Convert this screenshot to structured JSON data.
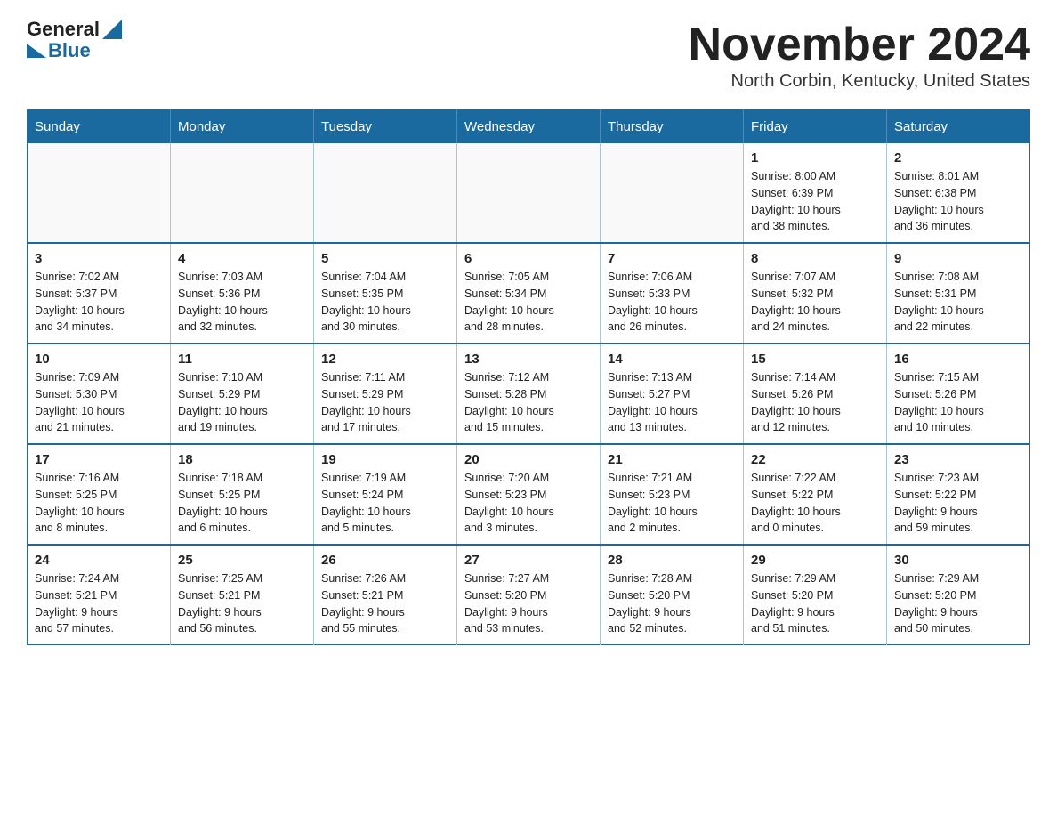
{
  "logo": {
    "general": "General",
    "blue": "Blue"
  },
  "title": "November 2024",
  "subtitle": "North Corbin, Kentucky, United States",
  "days_of_week": [
    "Sunday",
    "Monday",
    "Tuesday",
    "Wednesday",
    "Thursday",
    "Friday",
    "Saturday"
  ],
  "weeks": [
    [
      {
        "day": "",
        "info": ""
      },
      {
        "day": "",
        "info": ""
      },
      {
        "day": "",
        "info": ""
      },
      {
        "day": "",
        "info": ""
      },
      {
        "day": "",
        "info": ""
      },
      {
        "day": "1",
        "info": "Sunrise: 8:00 AM\nSunset: 6:39 PM\nDaylight: 10 hours\nand 38 minutes."
      },
      {
        "day": "2",
        "info": "Sunrise: 8:01 AM\nSunset: 6:38 PM\nDaylight: 10 hours\nand 36 minutes."
      }
    ],
    [
      {
        "day": "3",
        "info": "Sunrise: 7:02 AM\nSunset: 5:37 PM\nDaylight: 10 hours\nand 34 minutes."
      },
      {
        "day": "4",
        "info": "Sunrise: 7:03 AM\nSunset: 5:36 PM\nDaylight: 10 hours\nand 32 minutes."
      },
      {
        "day": "5",
        "info": "Sunrise: 7:04 AM\nSunset: 5:35 PM\nDaylight: 10 hours\nand 30 minutes."
      },
      {
        "day": "6",
        "info": "Sunrise: 7:05 AM\nSunset: 5:34 PM\nDaylight: 10 hours\nand 28 minutes."
      },
      {
        "day": "7",
        "info": "Sunrise: 7:06 AM\nSunset: 5:33 PM\nDaylight: 10 hours\nand 26 minutes."
      },
      {
        "day": "8",
        "info": "Sunrise: 7:07 AM\nSunset: 5:32 PM\nDaylight: 10 hours\nand 24 minutes."
      },
      {
        "day": "9",
        "info": "Sunrise: 7:08 AM\nSunset: 5:31 PM\nDaylight: 10 hours\nand 22 minutes."
      }
    ],
    [
      {
        "day": "10",
        "info": "Sunrise: 7:09 AM\nSunset: 5:30 PM\nDaylight: 10 hours\nand 21 minutes."
      },
      {
        "day": "11",
        "info": "Sunrise: 7:10 AM\nSunset: 5:29 PM\nDaylight: 10 hours\nand 19 minutes."
      },
      {
        "day": "12",
        "info": "Sunrise: 7:11 AM\nSunset: 5:29 PM\nDaylight: 10 hours\nand 17 minutes."
      },
      {
        "day": "13",
        "info": "Sunrise: 7:12 AM\nSunset: 5:28 PM\nDaylight: 10 hours\nand 15 minutes."
      },
      {
        "day": "14",
        "info": "Sunrise: 7:13 AM\nSunset: 5:27 PM\nDaylight: 10 hours\nand 13 minutes."
      },
      {
        "day": "15",
        "info": "Sunrise: 7:14 AM\nSunset: 5:26 PM\nDaylight: 10 hours\nand 12 minutes."
      },
      {
        "day": "16",
        "info": "Sunrise: 7:15 AM\nSunset: 5:26 PM\nDaylight: 10 hours\nand 10 minutes."
      }
    ],
    [
      {
        "day": "17",
        "info": "Sunrise: 7:16 AM\nSunset: 5:25 PM\nDaylight: 10 hours\nand 8 minutes."
      },
      {
        "day": "18",
        "info": "Sunrise: 7:18 AM\nSunset: 5:25 PM\nDaylight: 10 hours\nand 6 minutes."
      },
      {
        "day": "19",
        "info": "Sunrise: 7:19 AM\nSunset: 5:24 PM\nDaylight: 10 hours\nand 5 minutes."
      },
      {
        "day": "20",
        "info": "Sunrise: 7:20 AM\nSunset: 5:23 PM\nDaylight: 10 hours\nand 3 minutes."
      },
      {
        "day": "21",
        "info": "Sunrise: 7:21 AM\nSunset: 5:23 PM\nDaylight: 10 hours\nand 2 minutes."
      },
      {
        "day": "22",
        "info": "Sunrise: 7:22 AM\nSunset: 5:22 PM\nDaylight: 10 hours\nand 0 minutes."
      },
      {
        "day": "23",
        "info": "Sunrise: 7:23 AM\nSunset: 5:22 PM\nDaylight: 9 hours\nand 59 minutes."
      }
    ],
    [
      {
        "day": "24",
        "info": "Sunrise: 7:24 AM\nSunset: 5:21 PM\nDaylight: 9 hours\nand 57 minutes."
      },
      {
        "day": "25",
        "info": "Sunrise: 7:25 AM\nSunset: 5:21 PM\nDaylight: 9 hours\nand 56 minutes."
      },
      {
        "day": "26",
        "info": "Sunrise: 7:26 AM\nSunset: 5:21 PM\nDaylight: 9 hours\nand 55 minutes."
      },
      {
        "day": "27",
        "info": "Sunrise: 7:27 AM\nSunset: 5:20 PM\nDaylight: 9 hours\nand 53 minutes."
      },
      {
        "day": "28",
        "info": "Sunrise: 7:28 AM\nSunset: 5:20 PM\nDaylight: 9 hours\nand 52 minutes."
      },
      {
        "day": "29",
        "info": "Sunrise: 7:29 AM\nSunset: 5:20 PM\nDaylight: 9 hours\nand 51 minutes."
      },
      {
        "day": "30",
        "info": "Sunrise: 7:29 AM\nSunset: 5:20 PM\nDaylight: 9 hours\nand 50 minutes."
      }
    ]
  ]
}
